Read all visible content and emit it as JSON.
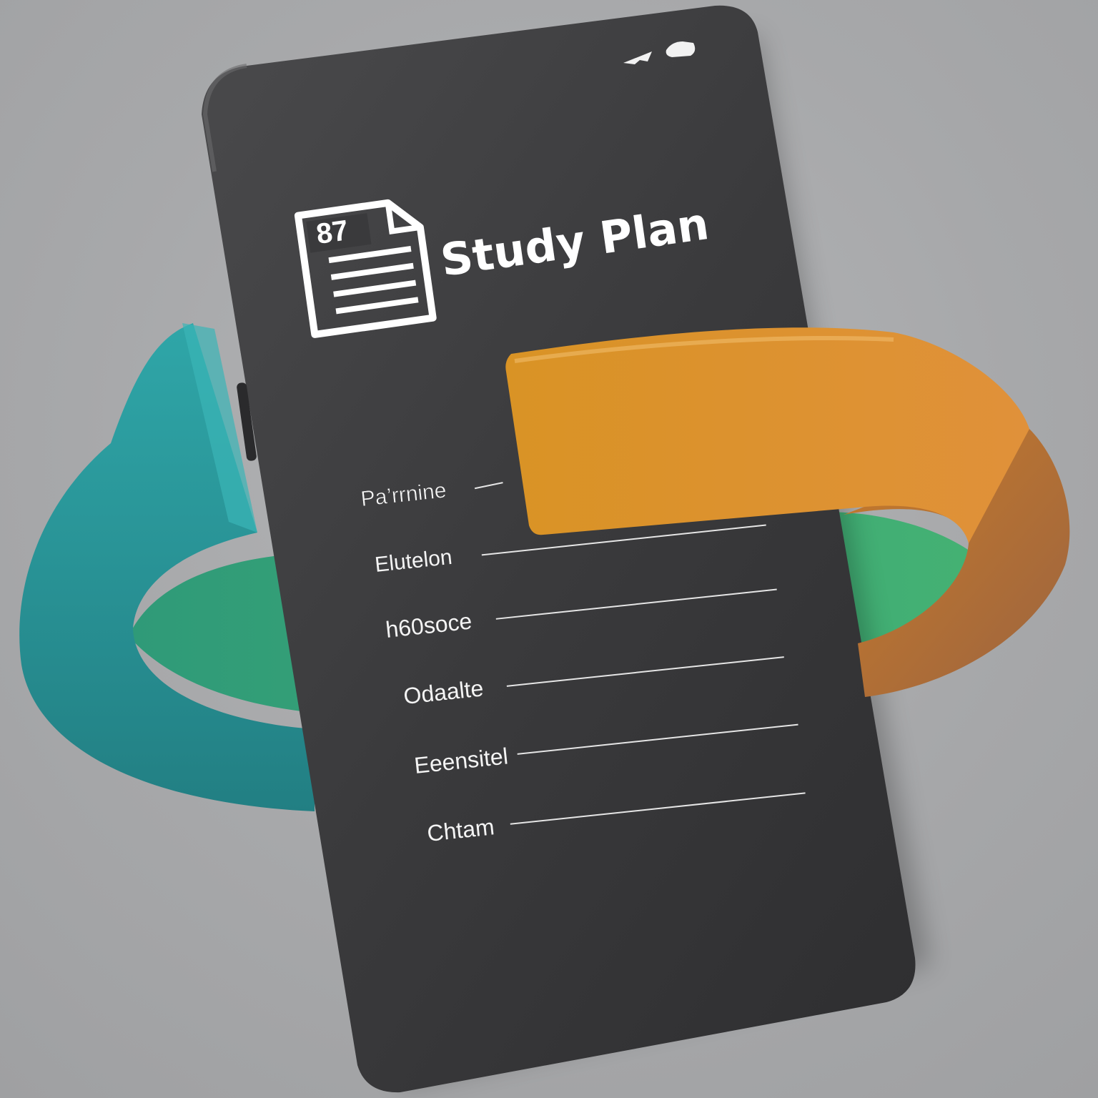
{
  "app": {
    "title": "Study Plan",
    "doc_badge": "87"
  },
  "plan_items": [
    "Pa’rrnine",
    "Elutelon",
    "h60soce",
    "Odaalte",
    "Eeensitel",
    "Chtam"
  ],
  "icons": {
    "document": "document-icon",
    "signal": "signal-icon",
    "battery": "battery-icon"
  },
  "colors": {
    "background": "#a8a9ab",
    "phone_body": "#3a3a3c",
    "ring_teal": "#2a9c9c",
    "ring_green": "#3aa573",
    "ring_orange": "#d98a26",
    "text": "#ffffff"
  }
}
